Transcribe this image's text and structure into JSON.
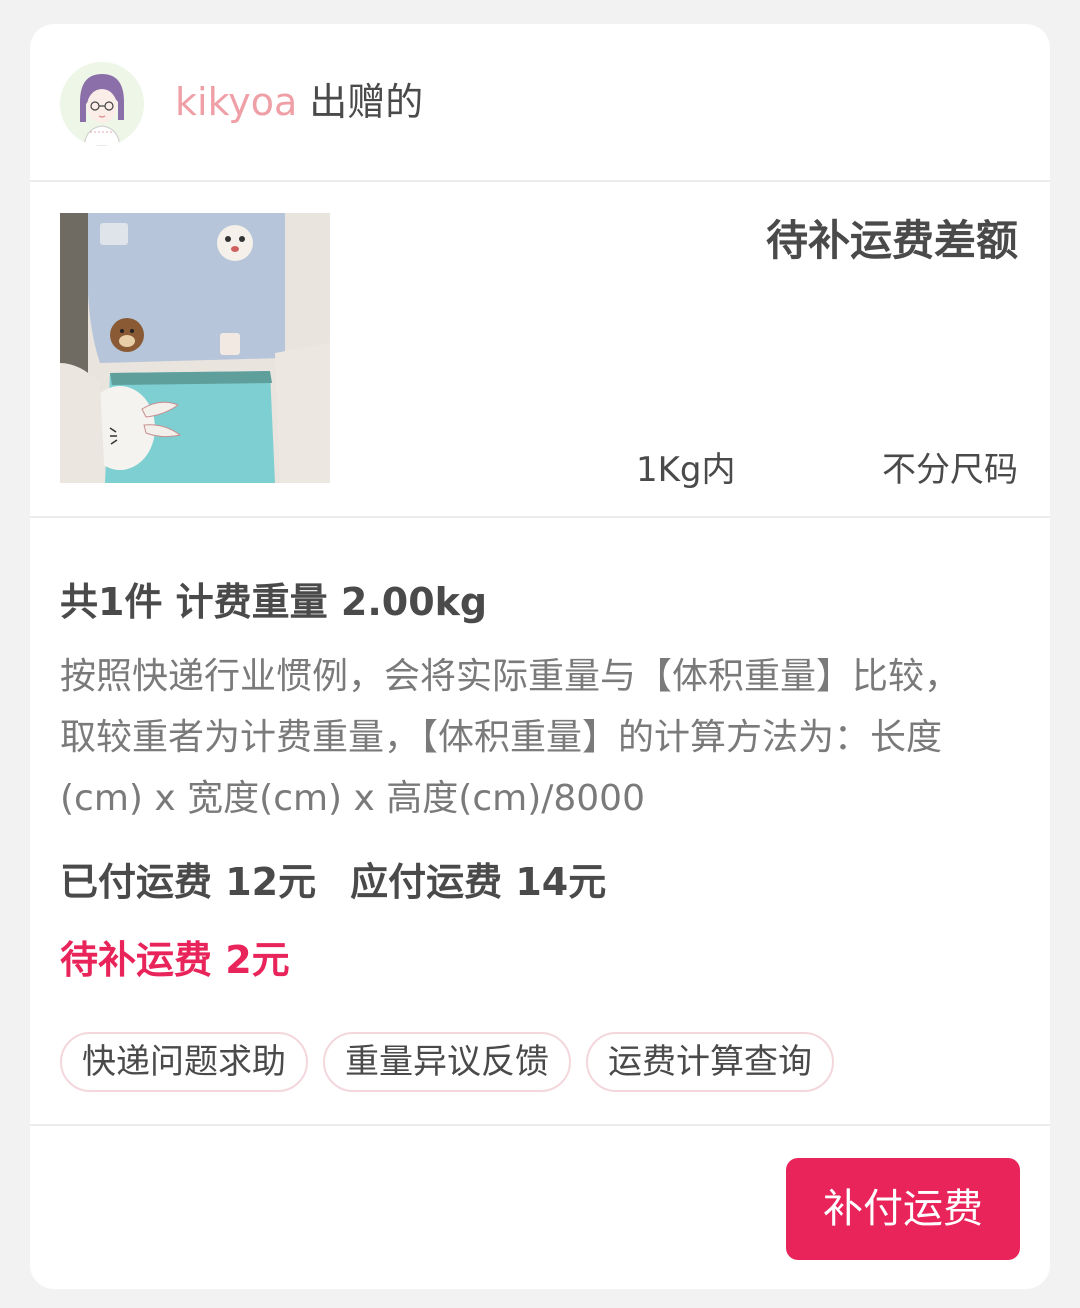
{
  "header": {
    "user_name": "kikyoa",
    "gift_label": "出赠的"
  },
  "product": {
    "title": "待补运费差额",
    "weight": "1Kg内",
    "size": "不分尺码"
  },
  "details": {
    "summary": "共1件 计费重量 2.00kg",
    "explanation": "按照快递行业惯例，会将实际重量与【体积重量】比较，取较重者为计费重量，【体积重量】的计算方法为：长度(cm) x 宽度(cm) x 高度(cm)/8000",
    "paid_fee": "已付运费 12元",
    "required_fee": "应付运费 14元",
    "due_fee": "待补运费 2元"
  },
  "tags": [
    "快递问题求助",
    "重量异议反馈",
    "运费计算查询"
  ],
  "actions": {
    "pay_button": "补付运费"
  },
  "colors": {
    "accent": "#e8245a",
    "username": "#ef9fa6",
    "tag_border": "#f3d7dc",
    "background": "#f2f2f2"
  }
}
